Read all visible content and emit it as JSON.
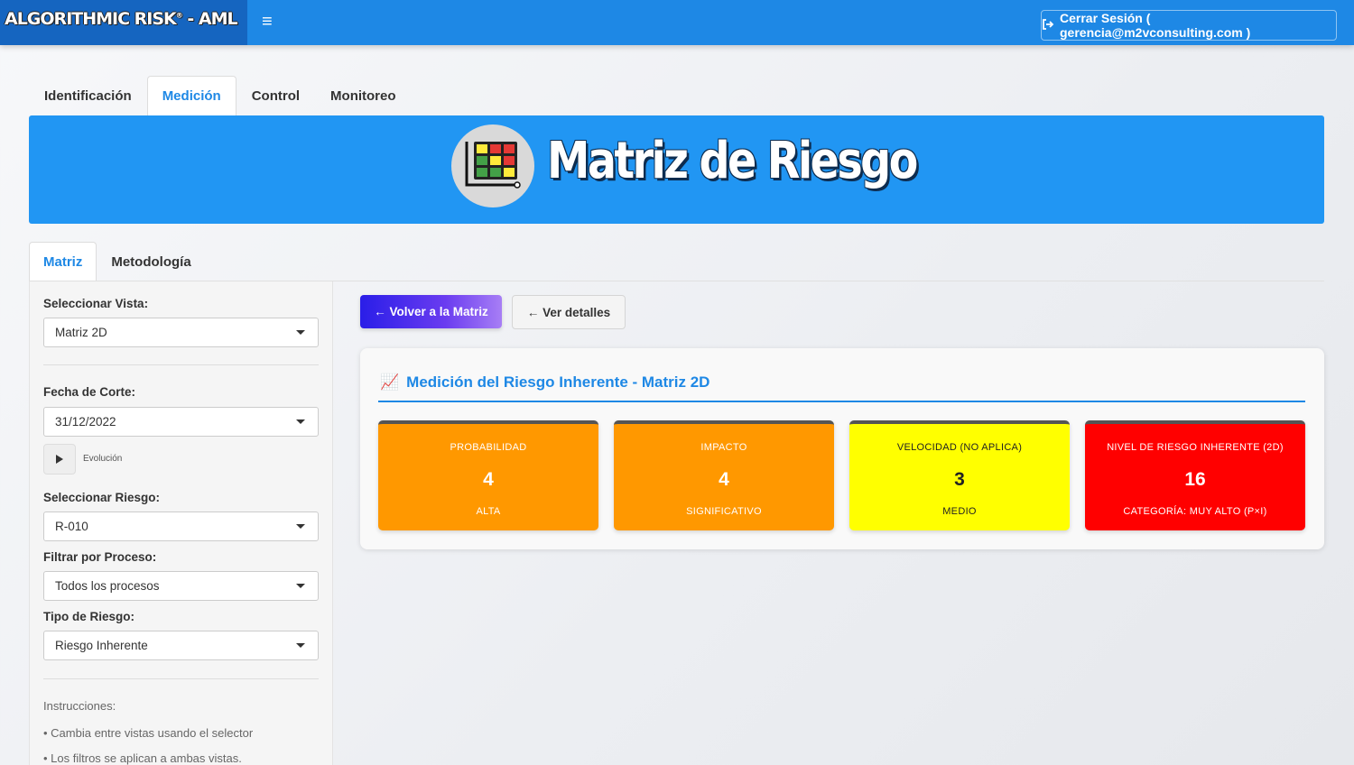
{
  "app": {
    "brand": "ALGORITHMIC RISK",
    "brand_mark": "®",
    "brand_suffix": " - AML",
    "logout_label": "Cerrar Sesión ( gerencia@m2vconsulting.com )"
  },
  "main_tabs": [
    {
      "label": "Identificación",
      "active": false
    },
    {
      "label": "Medición",
      "active": true
    },
    {
      "label": "Control",
      "active": false
    },
    {
      "label": "Monitoreo",
      "active": false
    }
  ],
  "banner": {
    "title": "Matriz de Riesgo",
    "icon": "risk-matrix-icon"
  },
  "sub_tabs": [
    {
      "label": "Matriz",
      "active": true
    },
    {
      "label": "Metodología",
      "active": false
    }
  ],
  "sidebar": {
    "vista_label": "Seleccionar Vista:",
    "vista_value": "Matriz 2D",
    "fecha_label": "Fecha de Corte:",
    "fecha_value": "31/12/2022",
    "evolucion_label": "Evolución",
    "riesgo_label": "Seleccionar Riesgo:",
    "riesgo_value": "R-010",
    "proceso_label": "Filtrar por Proceso:",
    "proceso_value": "Todos los procesos",
    "tipo_label": "Tipo de Riesgo:",
    "tipo_value": "Riesgo Inherente",
    "instr_title": "Instrucciones:",
    "instr_1": "• Cambia entre vistas usando el selector",
    "instr_2": "• Los filtros se aplican a ambas vistas."
  },
  "actions": {
    "back_label": "← Volver a la Matriz",
    "details_label": "← Ver detalles"
  },
  "panel": {
    "title": "Medición del Riesgo Inherente - Matriz 2D",
    "title_icon": "📈",
    "cards": [
      {
        "label": "PROBABILIDAD",
        "value": "4",
        "sub": "ALTA",
        "bg": "#ff9800",
        "fg": "#ffffff"
      },
      {
        "label": "IMPACTO",
        "value": "4",
        "sub": "SIGNIFICATIVO",
        "bg": "#ff9800",
        "fg": "#ffffff"
      },
      {
        "label": "VELOCIDAD (NO APLICA)",
        "value": "3",
        "sub": "MEDIO",
        "bg": "#ffff00",
        "fg": "#222222"
      },
      {
        "label": "NIVEL DE RIESGO INHERENTE (2D)",
        "value": "16",
        "sub": "CATEGORÍA: MUY ALTO (P×I)",
        "bg": "#ff0000",
        "fg": "#ffffff"
      }
    ]
  },
  "colors": {
    "primary": "#1e88e5",
    "banner": "#2196f3",
    "brand_bg": "#1565c0"
  }
}
